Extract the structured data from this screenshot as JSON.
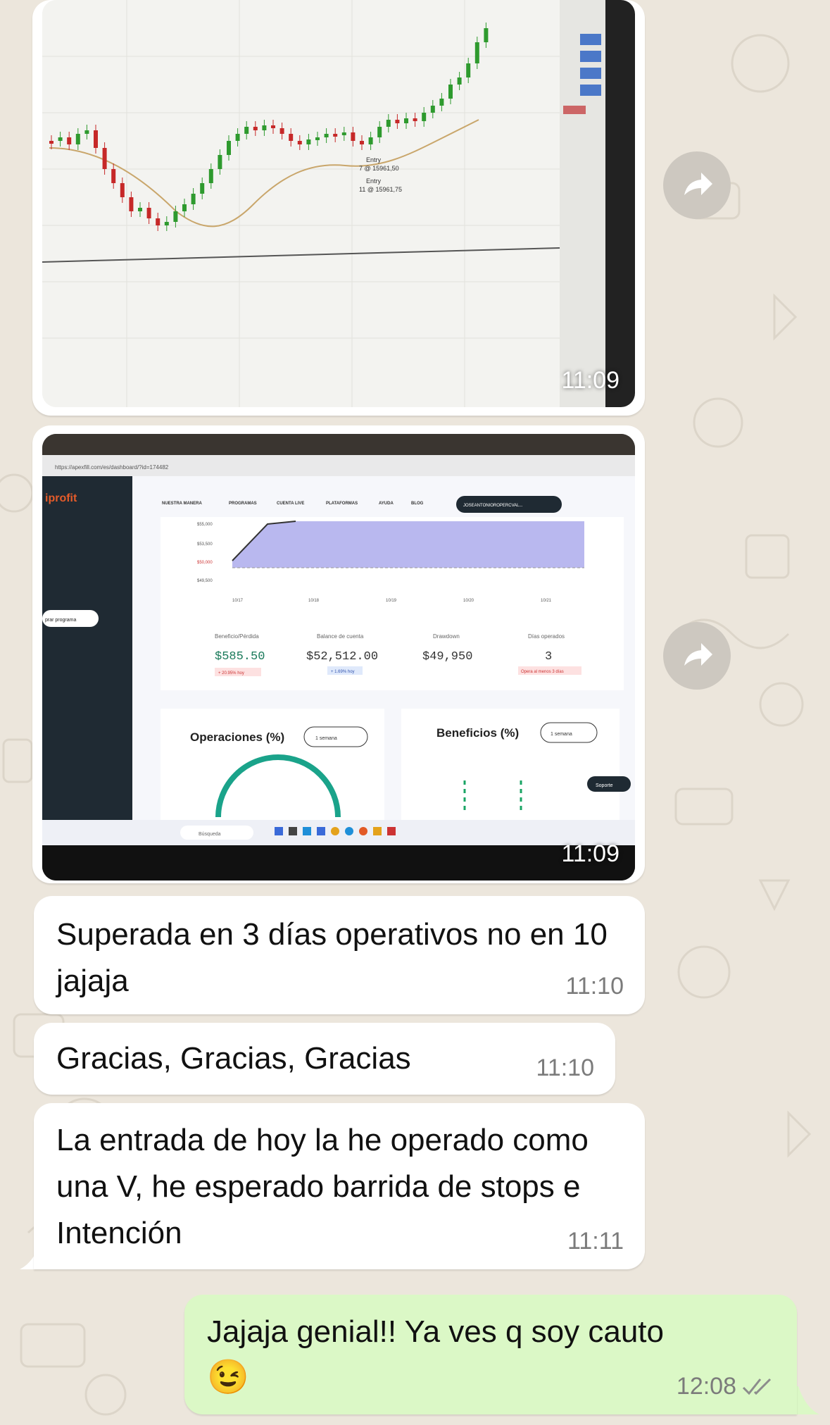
{
  "chat": {
    "photo1": {
      "time": "11:09",
      "chart_labels": [
        "Entry",
        "7 @ 15961,50",
        "Entry",
        "11 @ 15961,75"
      ]
    },
    "photo2": {
      "time": "11:09",
      "url": "https://apexfill.com/es/dashboard/?id=174482",
      "brand": "iprofit",
      "nav": [
        "NUESTRA MANERA",
        "PROGRAMAS",
        "CUENTA LIVE",
        "PLATAFORMAS",
        "AYUDA",
        "BLOG"
      ],
      "user_pill": "JOSEANTONIOROPERCVAL...",
      "sidebar_button": "prar programa",
      "y_axis": [
        "$55,000",
        "$53,500",
        "$50,000",
        "$49,500"
      ],
      "x_axis": [
        "10/17",
        "10/18",
        "10/19",
        "10/20",
        "10/21"
      ],
      "stats": [
        {
          "label": "Beneficio/Pérdida",
          "value": "$585.50",
          "badge": "+ 20.95% hoy"
        },
        {
          "label": "Balance de cuenta",
          "value": "$52,512.00",
          "badge": "+ 1.69% hoy"
        },
        {
          "label": "Drawdown",
          "value": "$49,950",
          "badge": ""
        },
        {
          "label": "Días operados",
          "value": "3",
          "badge": "Opera al menos 3 días"
        }
      ],
      "operaciones_title": "Operaciones (%)",
      "operaciones_select": "1 semana",
      "beneficios_title": "Beneficios (%)",
      "beneficios_select": "1 semana",
      "support": "Soporte",
      "search_placeholder": "Búsqueda"
    },
    "messages": [
      {
        "text": "Superada en 3 días operativos no en 10 jajaja",
        "time": "11:10"
      },
      {
        "text": "Gracias, Gracias, Gracias",
        "time": "11:10"
      },
      {
        "text": "La entrada de hoy la he operado como una V, he esperado barrida de stops e Intención",
        "time": "11:11"
      }
    ],
    "outgoing": {
      "text": "Jajaja genial!! Ya ves q soy cauto",
      "emoji": "😉",
      "time": "12:08",
      "status": "read"
    }
  },
  "colors": {
    "wallpaper": "#ece6dc",
    "incoming_bubble": "#ffffff",
    "outgoing_bubble": "#dbf8c6",
    "read_ticks": "#8c8c8c",
    "candle_up": "#2e9a2e",
    "candle_down": "#c62828"
  },
  "icons": [
    "forward-icon",
    "double-check-icon",
    "winking-face-emoji"
  ]
}
